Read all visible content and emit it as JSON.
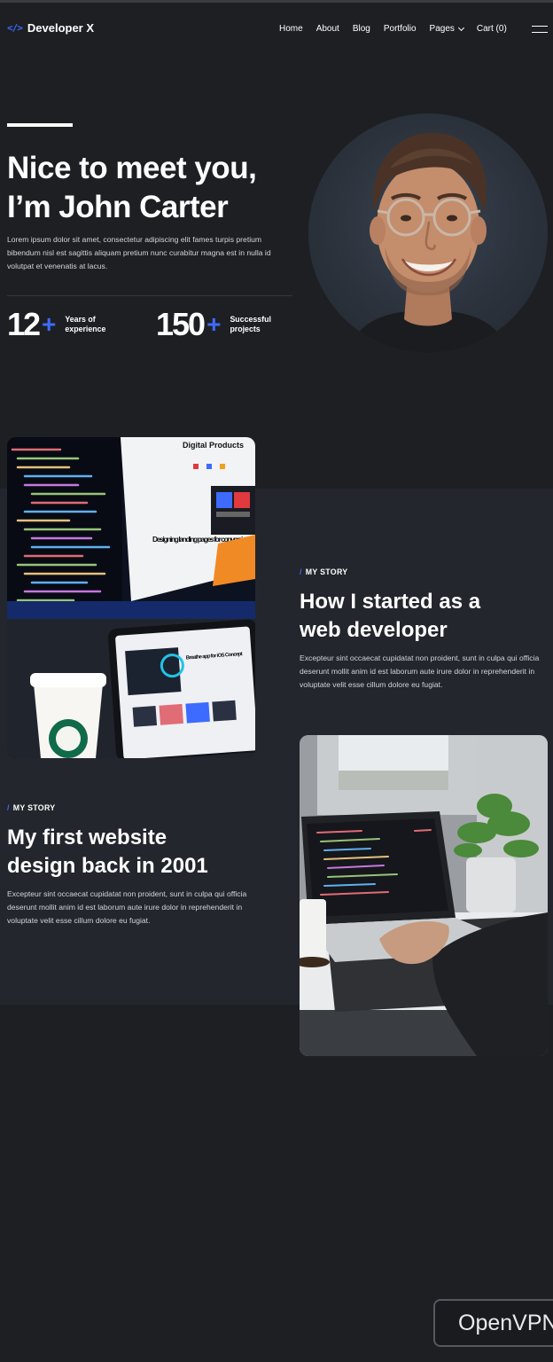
{
  "nav": {
    "brand_icon": "</>",
    "brand_name": "Developer X",
    "items": [
      {
        "label": "Home"
      },
      {
        "label": "About"
      },
      {
        "label": "Blog"
      },
      {
        "label": "Portfolio"
      },
      {
        "label": "Pages"
      },
      {
        "label": "Cart (0)"
      }
    ]
  },
  "hero": {
    "title_line1": "Nice to meet you,",
    "title_line2": "I’m John Carter",
    "text": "Lorem ipsum dolor sit amet, consectetur adipiscing elit fames turpis pretium bibendum nisl est sagittis aliquam pretium nunc curabitur magna est in nulla id volutpat et venenatis at lacus.",
    "stats": [
      {
        "number": "12",
        "plus": "+",
        "label": "Years of experience"
      },
      {
        "number": "150",
        "plus": "+",
        "label": "Successful projects"
      }
    ]
  },
  "stories": [
    {
      "kicker_slash": "/",
      "kicker": "MY STORY",
      "title_line1": "How I started as a",
      "title_line2": "web developer",
      "text": "Excepteur sint occaecat cupidatat non proident, sunt in culpa qui officia deserunt mollit anim id est laborum aute irure dolor in reprehenderit in voluptate velit esse cillum dolore eu fugiat."
    },
    {
      "kicker_slash": "/",
      "kicker": "MY STORY",
      "title_line1": "My first website",
      "title_line2": "design back in 2001",
      "text": "Excepteur sint occaecat cupidatat non proident, sunt in culpa qui officia deserunt mollit anim id est laborum aute irure dolor in reprehenderit in voluptate velit esse cillum dolore eu fugiat."
    }
  ],
  "image1": {
    "heading": "Digital Products",
    "card_title": "Designing landing pages for conversion",
    "tablet_title": "Breathe app for iOS Concept"
  },
  "overlay": {
    "vpn_label": "OpenVPN"
  },
  "colors": {
    "background": "#1d1f23",
    "band": "#23262c",
    "accent": "#3d6bff"
  }
}
